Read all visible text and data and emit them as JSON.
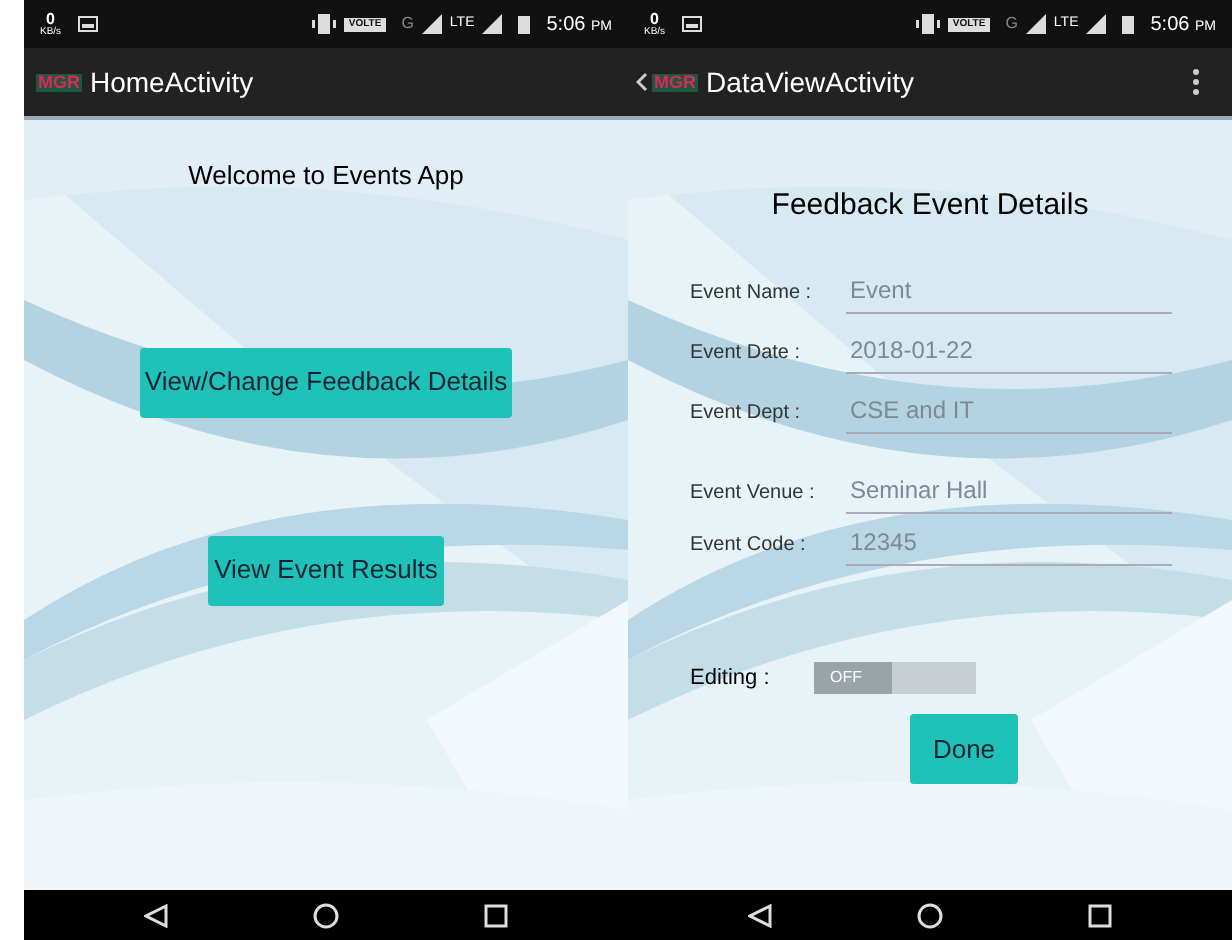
{
  "screens": [
    {
      "status_bar": {
        "speed": "0",
        "speed_unit": "KB/s",
        "volte": "VOLTE",
        "network": "G",
        "lte": "LTE",
        "time": "5:06",
        "time_suffix": "PM"
      },
      "app_bar": {
        "logo_text": "MGR",
        "title": "HomeActivity",
        "back": false,
        "overflow_menu": false
      },
      "kind": "home",
      "heading": "Welcome to Events App",
      "buttons": [
        "View/Change Feedback Details",
        "View Event Results"
      ]
    },
    {
      "status_bar": {
        "speed": "0",
        "speed_unit": "KB/s",
        "volte": "VOLTE",
        "network": "G",
        "lte": "LTE",
        "time": "5:06",
        "time_suffix": "PM"
      },
      "app_bar": {
        "logo_text": "MGR",
        "title": "DataViewActivity",
        "back": true,
        "overflow_menu": true
      },
      "kind": "form",
      "heading": "Feedback Event Details",
      "fields": [
        {
          "label": "Event Name :",
          "value": "Event"
        },
        {
          "label": "Event Date :",
          "value": "2018-01-22"
        },
        {
          "label": "Event Dept :",
          "value": "CSE and IT"
        },
        {
          "label": "Event Venue :",
          "value": "Seminar Hall"
        },
        {
          "label": "Event Code :",
          "value": "12345"
        }
      ],
      "editing": {
        "label": "Editing :",
        "on": false,
        "off_text": "OFF"
      },
      "buttons": [
        "Done"
      ]
    }
  ]
}
